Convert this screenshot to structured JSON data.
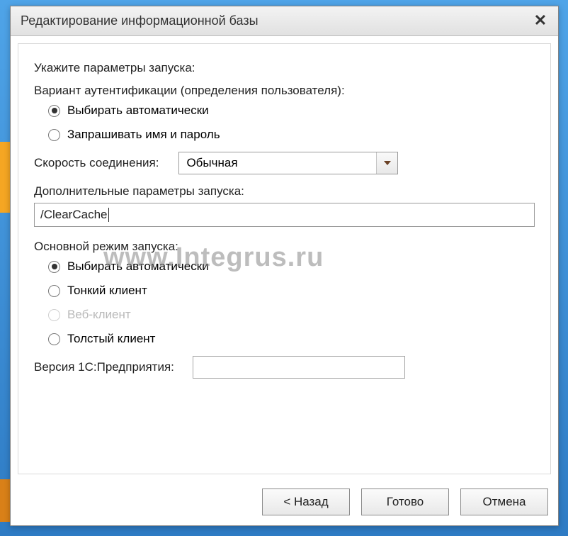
{
  "window": {
    "title": "Редактирование информационной базы"
  },
  "content": {
    "prompt": "Укажите параметры запуска:",
    "auth_label": "Вариант аутентификации (определения пользователя):",
    "auth_options": {
      "auto": "Выбирать автоматически",
      "ask": "Запрашивать имя и пароль"
    },
    "speed_label": "Скорость соединения:",
    "speed_value": "Обычная",
    "extra_params_label": "Дополнительные параметры запуска:",
    "extra_params_value": "/ClearCache",
    "mode_label": "Основной режим запуска:",
    "mode_options": {
      "auto": "Выбирать автоматически",
      "thin": "Тонкий клиент",
      "web": "Веб-клиент",
      "thick": "Толстый клиент"
    },
    "version_label": "Версия 1С:Предприятия:",
    "version_value": ""
  },
  "buttons": {
    "back": "< Назад",
    "finish": "Готово",
    "cancel": "Отмена"
  },
  "watermark": "www.Integrus.ru"
}
